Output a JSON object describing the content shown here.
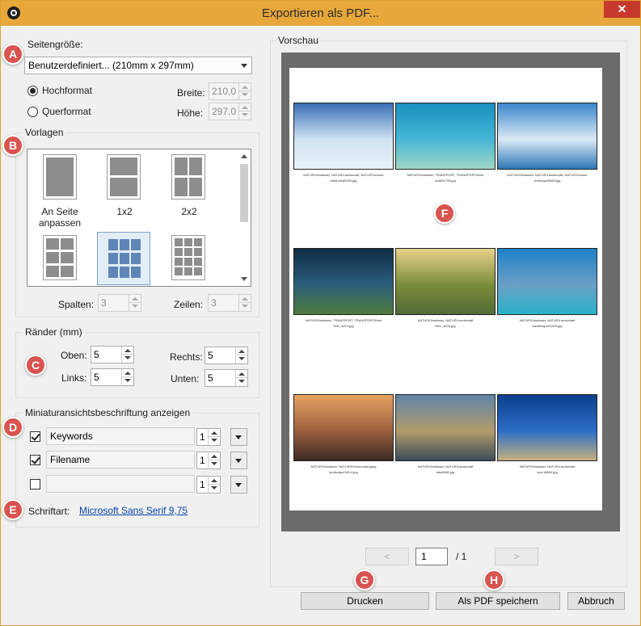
{
  "window": {
    "title": "Exportieren als PDF...",
    "close_glyph": "✕"
  },
  "markers": {
    "a": "A",
    "b": "B",
    "c": "C",
    "d": "D",
    "e": "E",
    "f": "F",
    "g": "G",
    "h": "H"
  },
  "page_size": {
    "label": "Seitengröße:",
    "selected": "Benutzerdefiniert... (210mm x 297mm)",
    "orientation_portrait": "Hochformat",
    "orientation_landscape": "Querformat",
    "portrait_checked": true,
    "width_label": "Breite:",
    "width_value": "210,0",
    "height_label": "Höhe:",
    "height_value": "297,0"
  },
  "templates": {
    "label": "Vorlagen",
    "items": [
      {
        "label": "An Seite\nanpassen",
        "cols": 1,
        "rows": 1
      },
      {
        "label": "1x2",
        "cols": 1,
        "rows": 2
      },
      {
        "label": "2x2",
        "cols": 2,
        "rows": 2
      },
      {
        "label": "",
        "cols": 2,
        "rows": 3
      },
      {
        "label": "",
        "cols": 3,
        "rows": 3,
        "selected": true
      },
      {
        "label": "",
        "cols": 3,
        "rows": 4
      }
    ],
    "columns_label": "Spalten:",
    "columns_value": "3",
    "rows_label": "Zeilen:",
    "rows_value": "3"
  },
  "margins": {
    "label": "Ränder (mm)",
    "top_label": "Oben:",
    "top_value": "5",
    "right_label": "Rechts:",
    "right_value": "5",
    "left_label": "Links:",
    "left_value": "5",
    "bottom_label": "Unten:",
    "bottom_value": "5"
  },
  "captions": {
    "label": "Miniaturansichtsbeschriftung anzeigen",
    "rows": [
      {
        "checked": true,
        "field": "Keywords",
        "size": "1"
      },
      {
        "checked": true,
        "field": "Filename",
        "size": "1"
      },
      {
        "checked": false,
        "field": "",
        "size": "1"
      }
    ],
    "font_label": "Schriftart:",
    "font_value": "Microsoft Sans Serif 9,75"
  },
  "preview": {
    "label": "Vorschau",
    "thumbnails": [
      {
        "caption1": "NATUR/Gewässer, NATUR/Landschaft, NATUR/Schnee",
        "caption2": "antarctica0535.jpg",
        "colors": [
          "#3a6fb6",
          "#cfe3f3",
          "#e9f2f8"
        ]
      },
      {
        "caption1": "NATUR/Gewässer, TRANSPORT, TRANSPORT/Boot",
        "caption2": "boat31735.jpg",
        "colors": [
          "#1a8fbf",
          "#46b7d6",
          "#9fd6c4"
        ]
      },
      {
        "caption1": "NATUR/Gewässer, NATUR/Landschaft, NATUR/Schnee",
        "caption2": "icebergs49465.jpg",
        "colors": [
          "#3a86cc",
          "#dbeaf5",
          "#2f76b5"
        ]
      },
      {
        "caption1": "NATUR/Gewässer, TRANSPORT, TRANSPORT/Boot",
        "caption2": "IMG_4873.jpg",
        "colors": [
          "#0e2c45",
          "#2c5f7c",
          "#4e7a3c"
        ]
      },
      {
        "caption1": "NATUR/Gewässer, NATUR/Landschaft",
        "caption2": "IMG_4876.jpg",
        "colors": [
          "#e7d38a",
          "#7b8d3a",
          "#536b36"
        ]
      },
      {
        "caption1": "NATUR/Gewässer, NATUR/Landschaft",
        "caption2": "laketekapo93319.jpg",
        "colors": [
          "#1f7fc6",
          "#6aa0c7",
          "#29b2c9"
        ]
      },
      {
        "caption1": "NATUR/Gewässer, NATUR/Sonnenuntergang",
        "caption2": "landscape24011.jpg",
        "colors": [
          "#e6a261",
          "#9c5f3e",
          "#3a2a22"
        ]
      },
      {
        "caption1": "NATUR/Gewässer, NATUR/Landschaft",
        "caption2": "lake0680.jpg",
        "colors": [
          "#5f84a8",
          "#b39c6b",
          "#3c4c5a"
        ]
      },
      {
        "caption1": "NATUR/Gewässer, NATUR/Landschaft",
        "caption2": "sea-18893.jpg",
        "colors": [
          "#0d3e8c",
          "#2a6fc7",
          "#c6b07e"
        ]
      }
    ],
    "prev_label": "<",
    "next_label": ">",
    "page_value": "1",
    "page_total": "/ 1"
  },
  "buttons": {
    "print": "Drucken",
    "save_pdf": "Als PDF speichern",
    "cancel": "Abbruch"
  }
}
